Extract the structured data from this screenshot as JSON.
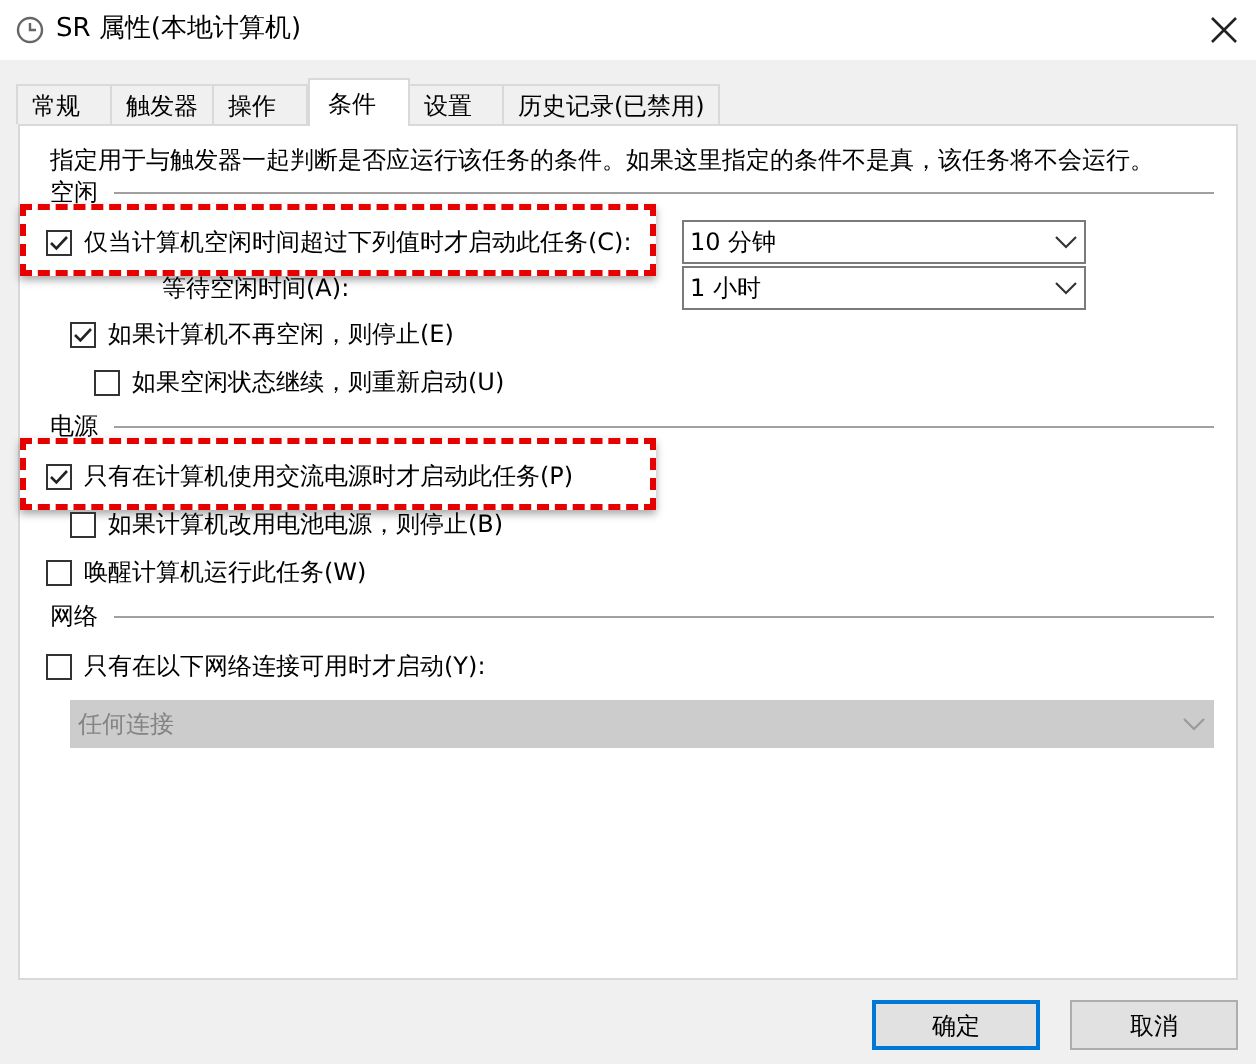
{
  "window": {
    "title": "SR 属性(本地计算机)"
  },
  "tabs": [
    {
      "label": "常规",
      "selected": false
    },
    {
      "label": "触发器",
      "selected": false
    },
    {
      "label": "操作",
      "selected": false
    },
    {
      "label": "条件",
      "selected": true
    },
    {
      "label": "设置",
      "selected": false
    },
    {
      "label": "历史记录(已禁用)",
      "selected": false
    }
  ],
  "description": "指定用于与触发器一起判断是否应运行该任务的条件。如果这里指定的条件不是真，该任务将不会运行。",
  "sections": [
    {
      "heading": "空闲",
      "items": [
        {
          "kind": "checkbox",
          "label": "仅当计算机空闲时间超过下列值时才启动此任务(C):",
          "checked": true,
          "highlighted": true,
          "combo": {
            "value": "10 分钟"
          },
          "children": [
            {
              "kind": "combo",
              "label": "等待空闲时间(A):",
              "value": "1 小时",
              "disabled": false
            },
            {
              "kind": "checkbox",
              "label": "如果计算机不再空闲，则停止(E)",
              "checked": true,
              "highlighted": false,
              "children": [
                {
                  "kind": "checkbox",
                  "label": "如果空闲状态继续，则重新启动(U)",
                  "checked": false,
                  "highlighted": false
                }
              ]
            }
          ]
        }
      ]
    },
    {
      "heading": "电源",
      "items": [
        {
          "kind": "checkbox",
          "label": "只有在计算机使用交流电源时才启动此任务(P)",
          "checked": true,
          "highlighted": true,
          "children": [
            {
              "kind": "checkbox",
              "label": "如果计算机改用电池电源，则停止(B)",
              "checked": false,
              "highlighted": false
            }
          ]
        },
        {
          "kind": "checkbox",
          "label": "唤醒计算机运行此任务(W)",
          "checked": false,
          "highlighted": false
        }
      ]
    },
    {
      "heading": "网络",
      "items": [
        {
          "kind": "checkbox",
          "label": "只有在以下网络连接可用时才启动(Y):",
          "checked": false,
          "highlighted": false,
          "children": [
            {
              "kind": "combo",
              "value": "任何连接",
              "disabled": true
            }
          ]
        }
      ]
    }
  ],
  "buttons": [
    {
      "label": "确定",
      "default": true
    },
    {
      "label": "取消",
      "default": false
    }
  ]
}
